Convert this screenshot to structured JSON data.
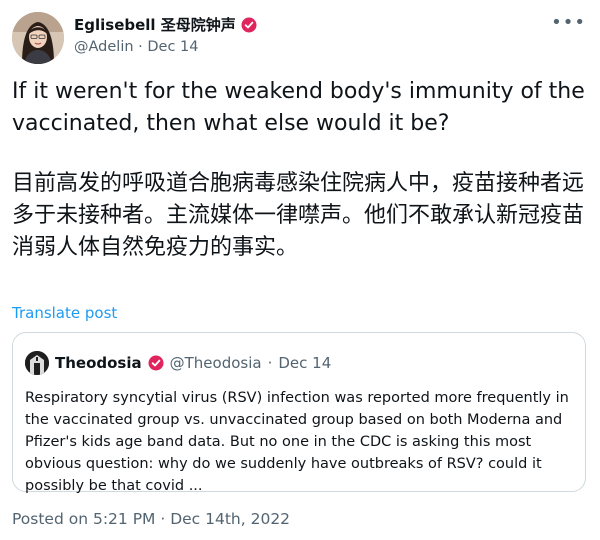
{
  "author": {
    "display_name": "Eglisebell 圣母院钟声",
    "handle": "@Adelin",
    "separator": "·",
    "date": "Dec 14",
    "avatar": "woman-portrait",
    "verified_icon": "verified-badge-icon"
  },
  "more_icon": "more-options-icon",
  "tweet": {
    "paragraph_en": "If it weren't for the weakend body's  immunity of the vaccinated, then what else would it be?",
    "paragraph_zh": "目前高发的呼吸道合胞病毒感染住院病人中，疫苗接种者远多于未接种者。主流媒体一律噤声。他们不敢承认新冠疫苗消弱人体自然免疫力的事实。"
  },
  "translate_label": "Translate post",
  "quote": {
    "display_name": "Theodosia",
    "handle": "@Theodosia",
    "separator": "·",
    "date": "Dec 14",
    "text": "Respiratory syncytial virus (RSV) infection was reported more frequently in the vaccinated group vs. unvaccinated group based on both Moderna and Pfizer's kids age band data. But no one in the CDC is asking this most obvious question: why do we suddenly have outbreaks of RSV? could it possibly be that covid ..."
  },
  "posted_line": "Posted on 5:21 PM · Dec 14th, 2022",
  "colors": {
    "verified": "#e0245e",
    "link": "#1d9bf0",
    "muted": "#536471",
    "border": "#cfd9de"
  }
}
